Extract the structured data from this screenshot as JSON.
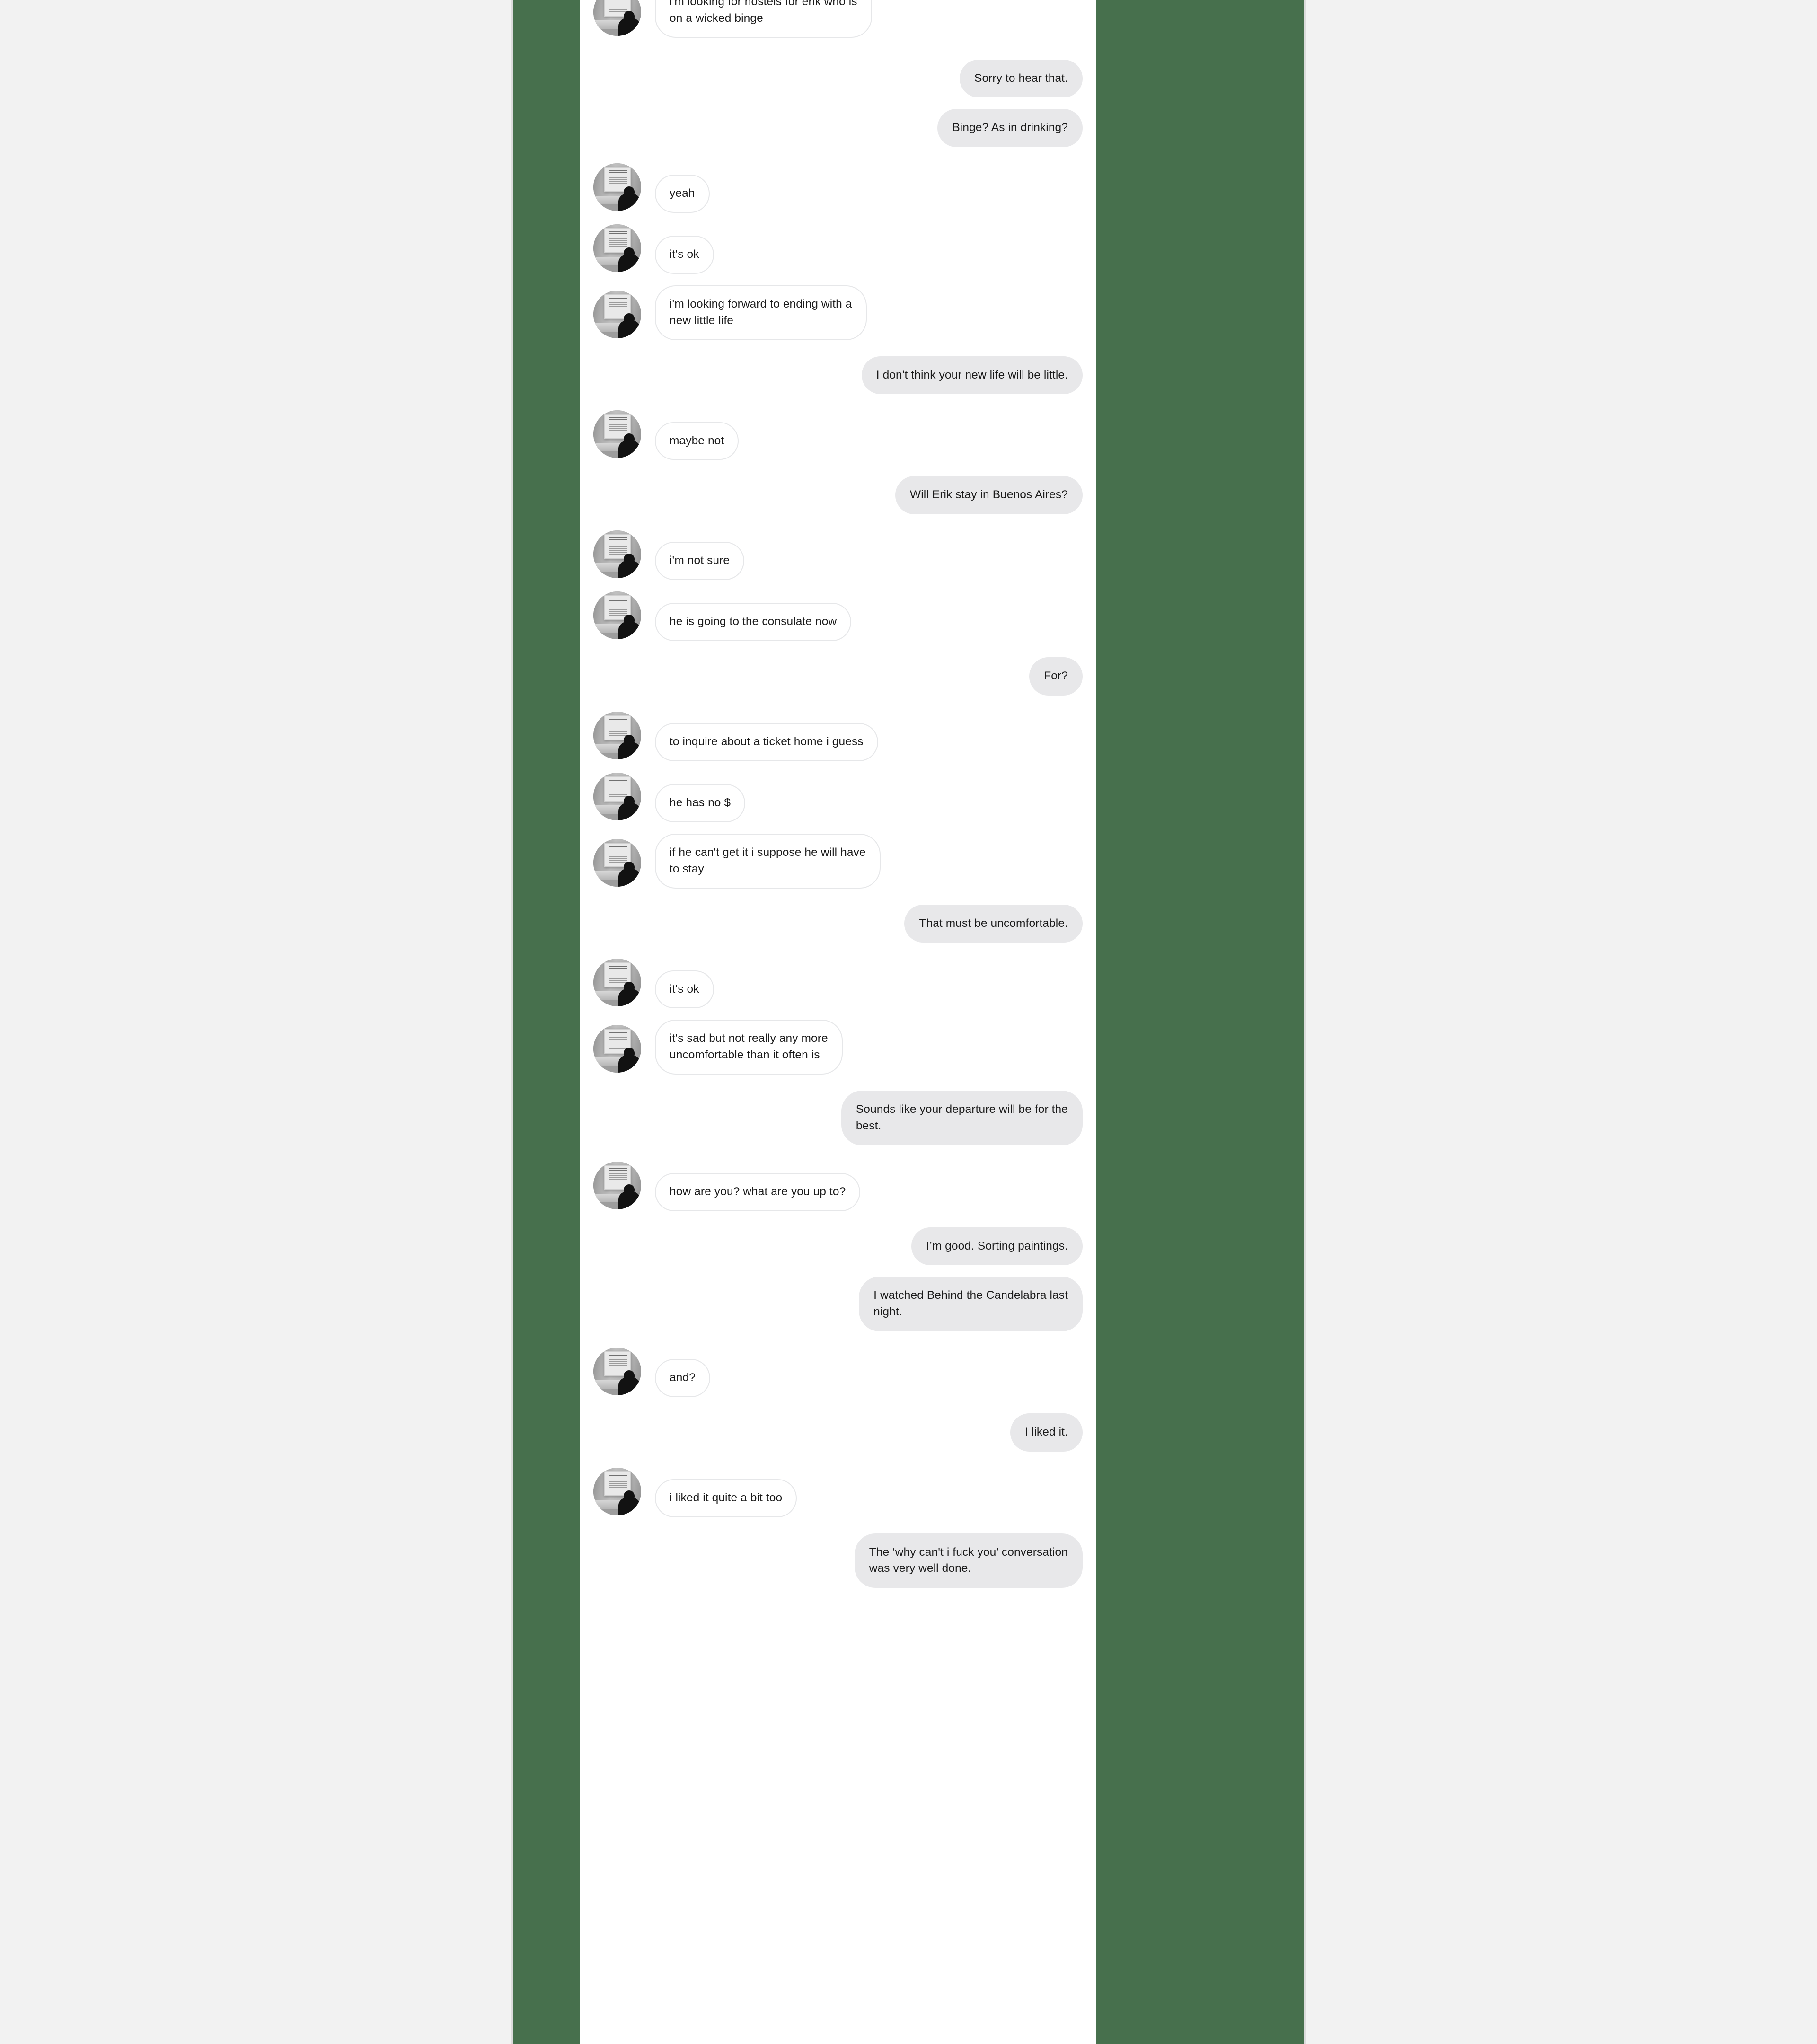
{
  "theme": {
    "page_background": "#f2f2f2",
    "panel_background": "#47704d",
    "sheet_background": "#ffffff",
    "incoming_bubble": "#ffffff",
    "incoming_border": "#e6e7e9",
    "outgoing_bubble": "#e8e8ea",
    "text_color": "#1a1a1a"
  },
  "avatar": {
    "icon": "person-viewing-framed-document-photo",
    "description": "grayscale photograph of a person in silhouette facing a framed document on a wall"
  },
  "conversation": {
    "messages": [
      {
        "side": "incoming",
        "text": "i'm looking for hostels for erik who is\non a wicked binge",
        "clipped_top": true
      },
      {
        "side": "outgoing",
        "text": "Sorry to hear that."
      },
      {
        "side": "outgoing",
        "text": "Binge? As in drinking?"
      },
      {
        "side": "incoming",
        "text": "yeah"
      },
      {
        "side": "incoming",
        "text": "it's ok"
      },
      {
        "side": "incoming",
        "text": "i'm looking forward to ending with a\nnew little life"
      },
      {
        "side": "outgoing",
        "text": "I don't think your new life will be little."
      },
      {
        "side": "incoming",
        "text": "maybe not"
      },
      {
        "side": "outgoing",
        "text": "Will Erik stay in Buenos Aires?"
      },
      {
        "side": "incoming",
        "text": "i'm not sure"
      },
      {
        "side": "incoming",
        "text": "he is going to the consulate now"
      },
      {
        "side": "outgoing",
        "text": "For?"
      },
      {
        "side": "incoming",
        "text": "to inquire about a ticket home i guess"
      },
      {
        "side": "incoming",
        "text": "he has no $"
      },
      {
        "side": "incoming",
        "text": "if he can't get it i suppose he will have\nto stay"
      },
      {
        "side": "outgoing",
        "text": "That must be uncomfortable."
      },
      {
        "side": "incoming",
        "text": "it's ok"
      },
      {
        "side": "incoming",
        "text": "it's sad but not really any more\nuncomfortable than it often is"
      },
      {
        "side": "outgoing",
        "text": "Sounds like your departure will be for the\nbest."
      },
      {
        "side": "incoming",
        "text": "how are you? what are you up to?"
      },
      {
        "side": "outgoing",
        "text": "I’m good. Sorting paintings."
      },
      {
        "side": "outgoing",
        "text": "I watched Behind the Candelabra last\nnight."
      },
      {
        "side": "incoming",
        "text": "and?"
      },
      {
        "side": "outgoing",
        "text": "I liked it."
      },
      {
        "side": "incoming",
        "text": "i liked it quite a bit too"
      },
      {
        "side": "outgoing",
        "text": "The ‘why can't i fuck you’ conversation\nwas very well done."
      }
    ]
  }
}
